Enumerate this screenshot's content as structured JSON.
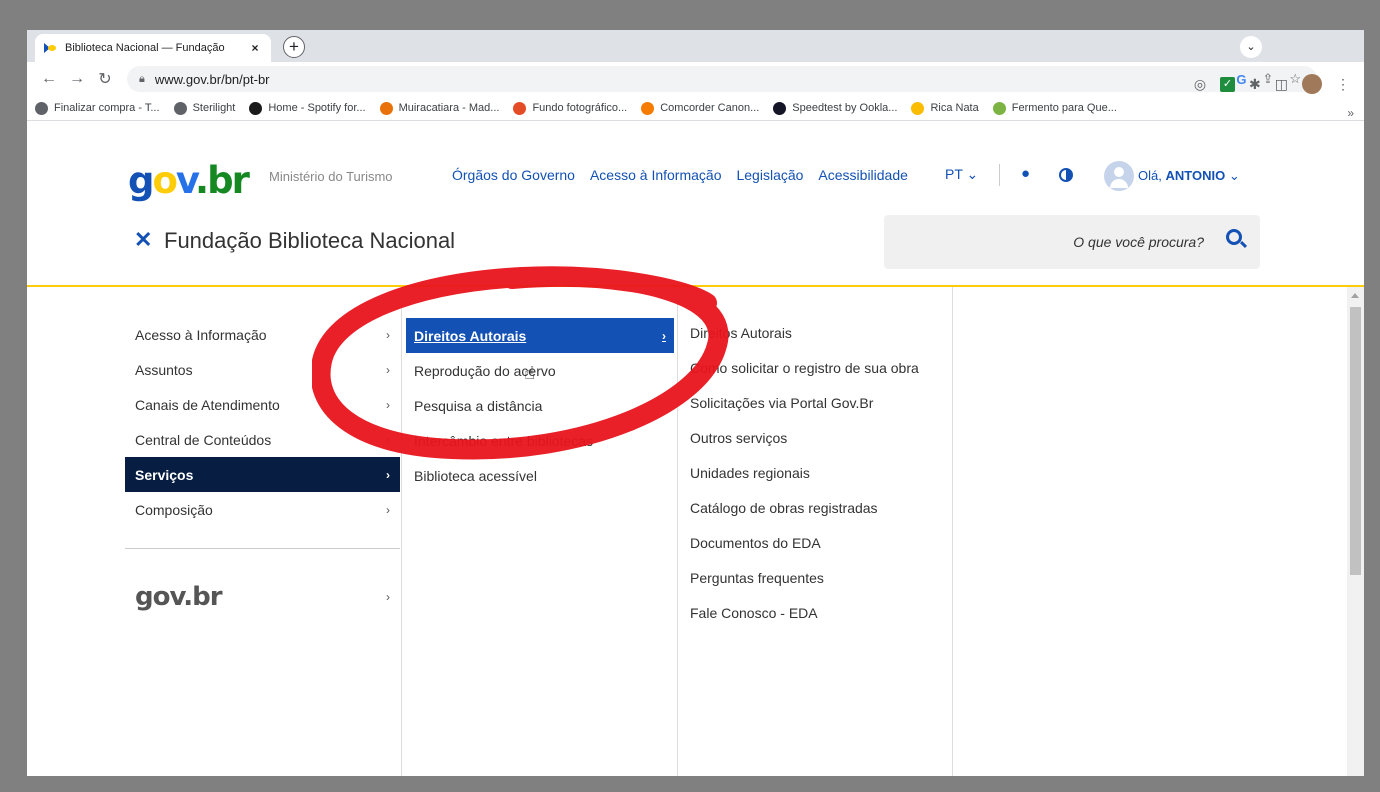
{
  "browser": {
    "tab_title": "Biblioteca Nacional — Fundação",
    "tab_close": "×",
    "new_tab": "+",
    "url": "www.gov.br/bn/pt-br",
    "bookmarks": [
      {
        "label": "Finalizar compra - T...",
        "color": "#5f6368"
      },
      {
        "label": "Sterilight",
        "color": "#5f6368"
      },
      {
        "label": "Home - Spotify for...",
        "color": "#1a1a1a"
      },
      {
        "label": "Muiracatiara - Mad...",
        "color": "#e8710a"
      },
      {
        "label": "Fundo fotográfico...",
        "color": "#e34c26"
      },
      {
        "label": "Comcorder Canon...",
        "color": "#f57c00"
      },
      {
        "label": "Speedtest by Ookla...",
        "color": "#141526"
      },
      {
        "label": "Rica Nata",
        "color": "#fbbc04"
      },
      {
        "label": "Fermento para Que...",
        "color": "#7cb342"
      }
    ],
    "bookmarks_more": "»"
  },
  "header": {
    "logo": {
      "g": "g",
      "o": "o",
      "v": "v",
      "br": ".br"
    },
    "ministry": "Ministério do Turismo",
    "nav": [
      "Órgãos do Governo",
      "Acesso à Informação",
      "Legislação",
      "Acessibilidade"
    ],
    "lang": "PT",
    "user_greeting": "Olá,",
    "user_name": "ANTONIO",
    "site_name": "Fundação Biblioteca Nacional",
    "close_icon": "✕",
    "search_placeholder": "O que você procura?"
  },
  "menu": {
    "col1": [
      {
        "label": "Acesso à Informação"
      },
      {
        "label": "Assuntos"
      },
      {
        "label": "Canais de Atendimento"
      },
      {
        "label": "Central de Conteúdos"
      },
      {
        "label": "Serviços",
        "active": true
      },
      {
        "label": "Composição"
      }
    ],
    "govbr_label": "gov.br",
    "col2": [
      {
        "label": "Direitos Autorais",
        "active": true
      },
      {
        "label": "Reprodução do acervo"
      },
      {
        "label": "Pesquisa a distância"
      },
      {
        "label": "Intercâmbio entre bibliotecas"
      },
      {
        "label": "Biblioteca acessível"
      }
    ],
    "col3": [
      "Direitos Autorais",
      "Como solicitar o registro de sua obra",
      "Solicitações via Portal Gov.Br",
      "Outros serviços",
      "Unidades regionais",
      "Catálogo de obras registradas",
      "Documentos do EDA",
      "Perguntas frequentes",
      "Fale Conosco - EDA"
    ],
    "arrow": "›"
  },
  "colors": {
    "gov_blue": "#1351b4",
    "gov_dark": "#071d41",
    "gov_yellow": "#ffcd07",
    "annotation_red": "#e8141c"
  }
}
